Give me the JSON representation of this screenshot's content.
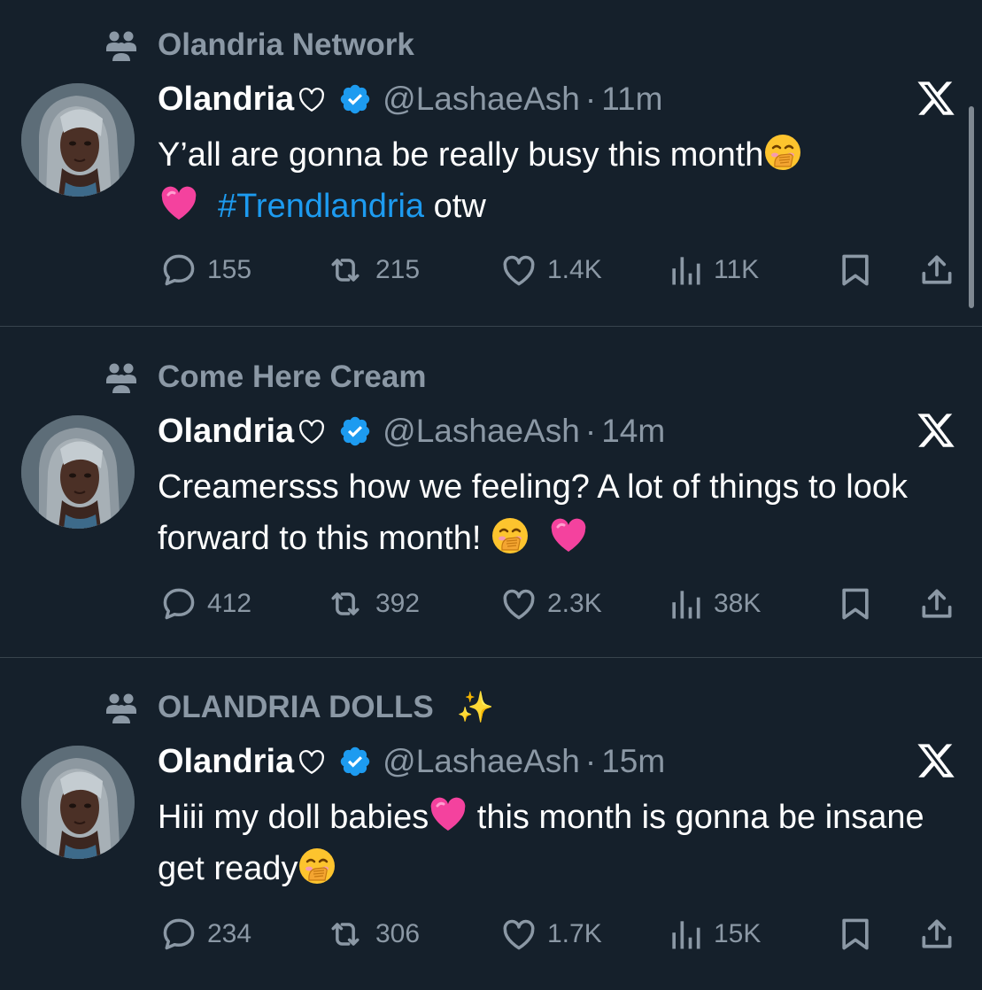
{
  "tweets": [
    {
      "community": "Olandria Network",
      "community_sparkle": "",
      "author": {
        "name": "Olandria",
        "handle": "@LashaeAsh",
        "time": "11m"
      },
      "text": {
        "p1": "Y’all are gonna be really busy this month",
        "p2": "#Trendlandria",
        "p3": " otw"
      },
      "stats": {
        "replies": "155",
        "reposts": "215",
        "likes": "1.4K",
        "views": "11K"
      }
    },
    {
      "community": "Come Here Cream",
      "community_sparkle": "",
      "author": {
        "name": "Olandria",
        "handle": "@LashaeAsh",
        "time": "14m"
      },
      "text": {
        "p1": "Creamersss how we feeling? A lot of things to look forward to this month! ",
        "p2": "",
        "p3": ""
      },
      "stats": {
        "replies": "412",
        "reposts": "392",
        "likes": "2.3K",
        "views": "38K"
      }
    },
    {
      "community": "OLANDRIA DOLLS",
      "community_sparkle": "✨",
      "author": {
        "name": "Olandria",
        "handle": "@LashaeAsh",
        "time": "15m"
      },
      "text": {
        "p1": "Hiii my doll babies",
        "p2": " this month is gonna be insane get ready",
        "p3": ""
      },
      "stats": {
        "replies": "234",
        "reposts": "306",
        "likes": "1.7K",
        "views": "15K"
      }
    }
  ],
  "icons": {
    "community": "community-icon",
    "verified": "verified-badge-icon",
    "logo": "x-logo-icon",
    "reply": "reply-icon",
    "repost": "repost-icon",
    "like": "like-icon",
    "views": "views-icon",
    "bookmark": "bookmark-icon",
    "share": "share-icon",
    "emoji_1": "hand-over-mouth-emoji",
    "emoji_2": "pink-heart-emoji"
  },
  "colors": {
    "background": "#15202b",
    "text": "#ffffff",
    "muted": "#8b98a5",
    "link": "#1d9bf0",
    "verified": "#1d9bf0",
    "divider": "#38444d"
  }
}
